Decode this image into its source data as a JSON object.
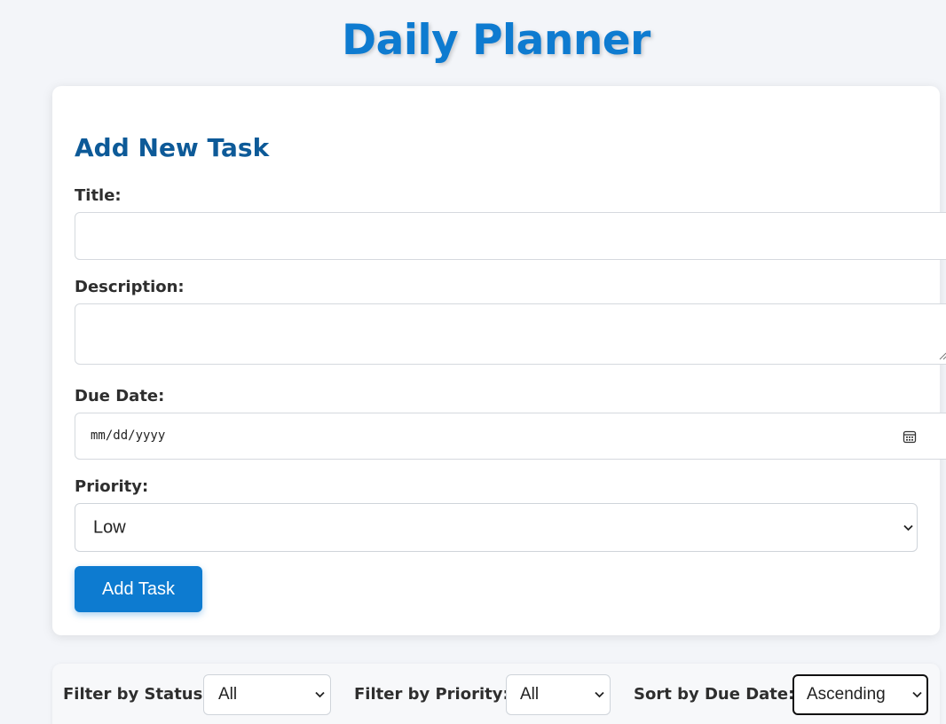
{
  "app": {
    "title": "Daily Planner"
  },
  "form": {
    "heading": "Add New Task",
    "title_label": "Title:",
    "title_value": "",
    "description_label": "Description:",
    "description_value": "",
    "due_date_label": "Due Date:",
    "due_date_placeholder": "mm/dd/yyyy",
    "priority_label": "Priority:",
    "priority_selected": "Low",
    "submit_label": "Add Task"
  },
  "filters": {
    "status_label": "Filter by Status:",
    "status_selected": "All",
    "priority_label": "Filter by Priority:",
    "priority_selected": "All",
    "sort_label": "Sort by Due Date:",
    "sort_selected": "Ascending"
  },
  "icons": {
    "date_picker": "calendar-icon",
    "dropdown": "chevron-down-icon",
    "resize": "resize-handle-icon"
  },
  "colors": {
    "accent": "#0d7bd0",
    "heading": "#0d5a98",
    "background": "#f3f5f9"
  }
}
